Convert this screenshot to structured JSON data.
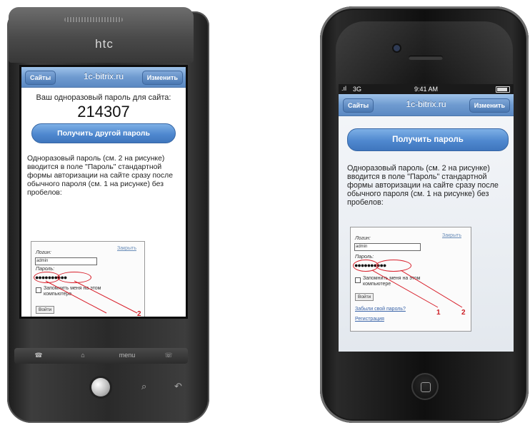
{
  "htc": {
    "brand": "htc",
    "navbar": {
      "left": "Сайты",
      "title": "1c-bitrix.ru",
      "right": "Изменить"
    },
    "otp_label": "Ваш одноразовый пароль для сайта:",
    "otp_value": "214307",
    "button": "Получить другой пароль",
    "description": "Одноразовый пароль (см. 2 на рисунке) вводится в поле \"Пароль\" стандартной формы авторизации на сайте сразу после обычного пароля (см. 1 на рисунке) без пробелов:",
    "form": {
      "login_label": "Логин:",
      "close": "Закрыть",
      "login_value": "admin",
      "password_label": "Пароль:",
      "password_dots": "●●●●●●●●●●",
      "remember": "Запомнить меня на этом компьютере",
      "submit": "Войти",
      "marker_2": "2"
    },
    "hw_menu": "menu"
  },
  "iphone": {
    "status": {
      "carrier": "3G",
      "time": "9:41 AM"
    },
    "navbar": {
      "left": "Сайты",
      "title": "1c-bitrix.ru",
      "right": "Изменить"
    },
    "button": "Получить пароль",
    "description": "Одноразовый пароль (см. 2 на рисунке) вводится в поле \"Пароль\" стандартной формы авторизации на сайте сразу после обычного пароля (см. 1 на рисунке) без пробелов:",
    "form": {
      "login_label": "Логин:",
      "close": "Закрыть",
      "login_value": "admin",
      "password_label": "Пароль:",
      "password_dots": "●●●●●●●●●●",
      "remember": "Запомнить меня на этом компьютере",
      "submit": "Войти",
      "forgot": "Забыли свой пароль?",
      "register": "Регистрация",
      "marker_1": "1",
      "marker_2": "2"
    }
  },
  "colors": {
    "accent_blue": "#4f88cf",
    "navbar_blue": "#6f9bd0",
    "marker_red": "#d81f2a"
  }
}
